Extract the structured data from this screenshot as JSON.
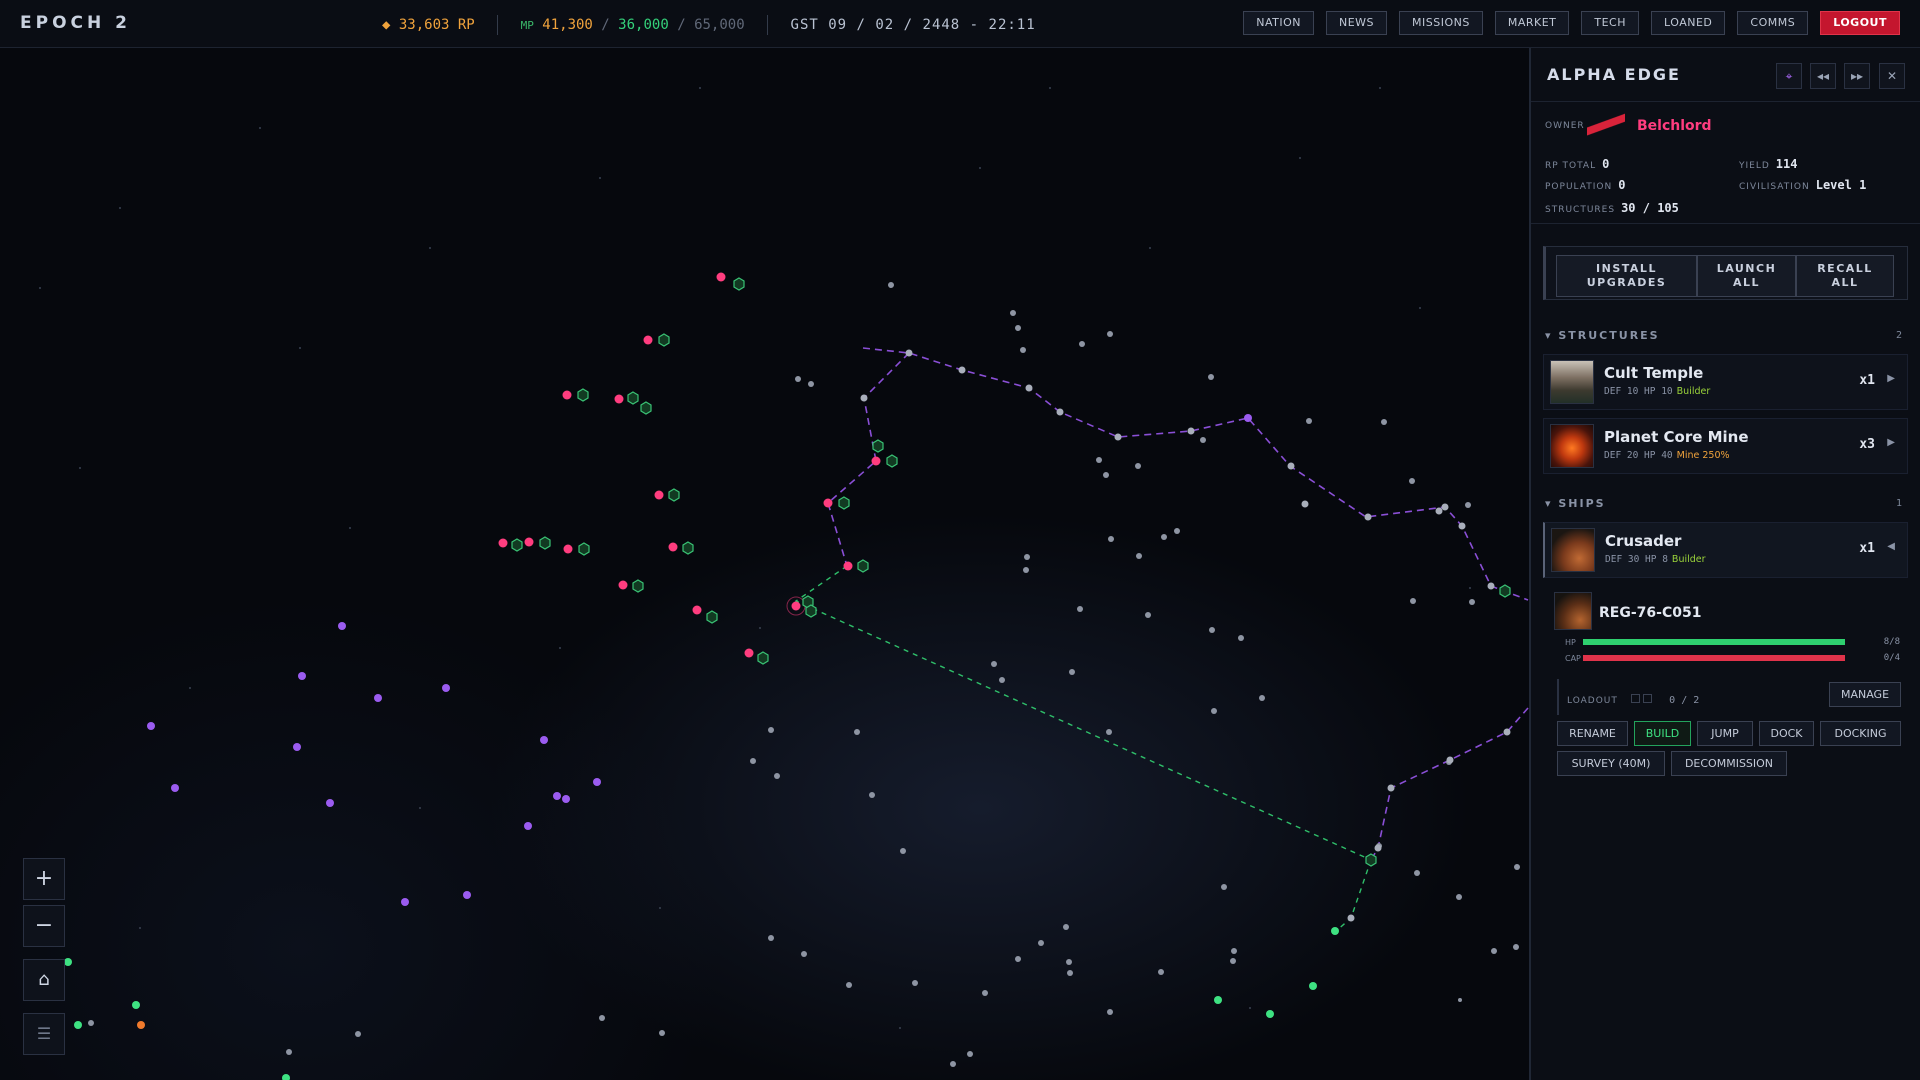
{
  "header": {
    "brand": "EPOCH 2",
    "rp": "◆ 33,603 RP",
    "mp_label": "MP",
    "mp_current": "41,300",
    "mp_max": "36,000",
    "mp_cap": "65,000",
    "slash": "/",
    "gst": "GST 09 / 02 / 2448 - 22:11",
    "nav": [
      "NATION",
      "NEWS",
      "MISSIONS",
      "MARKET",
      "TECH",
      "LOANED",
      "COMMS"
    ],
    "logout": "LOGOUT"
  },
  "map": {
    "zoom_in": "+",
    "zoom_out": "−",
    "home": "⌂",
    "chat": "☰"
  },
  "panel": {
    "title": "ALPHA EDGE",
    "locate_icon": "⌖",
    "prev_icon": "◂◂",
    "next_icon": "▸▸",
    "close_icon": "✕",
    "owner_label": "OWNER",
    "owner_name": "Belchlord",
    "rp_total_label": "RP TOTAL",
    "rp_total": "0",
    "yield_label": "YIELD",
    "yield": "114",
    "population_label": "POPULATION",
    "population": "0",
    "civilisation_label": "CIVILISATION",
    "civilisation": "Level 1",
    "structures_label": "STRUCTURES",
    "structures_value": "30 / 105",
    "actions": {
      "install_l1": "INSTALL",
      "install_l2": "UPGRADES",
      "launch_l1": "LAUNCH",
      "launch_l2": "ALL",
      "recall_l1": "RECALL",
      "recall_l2": "ALL"
    },
    "structures_header": "▾ STRUCTURES",
    "structures_count": "2",
    "structures": [
      {
        "name": "Cult Temple",
        "stats": "DEF 10 HP 10",
        "tag": "Builder",
        "qty": "x1",
        "arrow": "▶"
      },
      {
        "name": "Planet Core Mine",
        "stats": "DEF 20 HP 40",
        "tag": "Mine 250%",
        "qty": "x3",
        "arrow": "▶"
      }
    ],
    "ships_header": "▾ SHIPS",
    "ships_count": "1",
    "ships": [
      {
        "name": "Crusader",
        "stats": "DEF 30 HP 8",
        "tag": "Builder",
        "qty": "x1",
        "arrow": "◀"
      }
    ],
    "ship_detail": {
      "name": "REG-76-C051",
      "hp_label": "HP",
      "hp_value": "8/8",
      "hp_fraction": 1.0,
      "cap_label": "CAP",
      "cap_value": "0/4",
      "cap_fraction": 1.0,
      "loadout_label": "LOADOUT",
      "loadout_value": "0 / 2",
      "manage": "MANAGE",
      "buttons_row1": [
        "RENAME",
        "BUILD",
        "JUMP",
        "DOCK",
        "DOCKING"
      ],
      "buttons_row2": [
        "SURVEY (40M)",
        "DECOMMISSION"
      ]
    }
  },
  "colors": {
    "accent_pink": "#ff3d7f",
    "accent_green": "#3ee282",
    "accent_orange": "#f0a33c",
    "danger_red": "#c4162e",
    "route_purple": "#8a4fd6"
  }
}
